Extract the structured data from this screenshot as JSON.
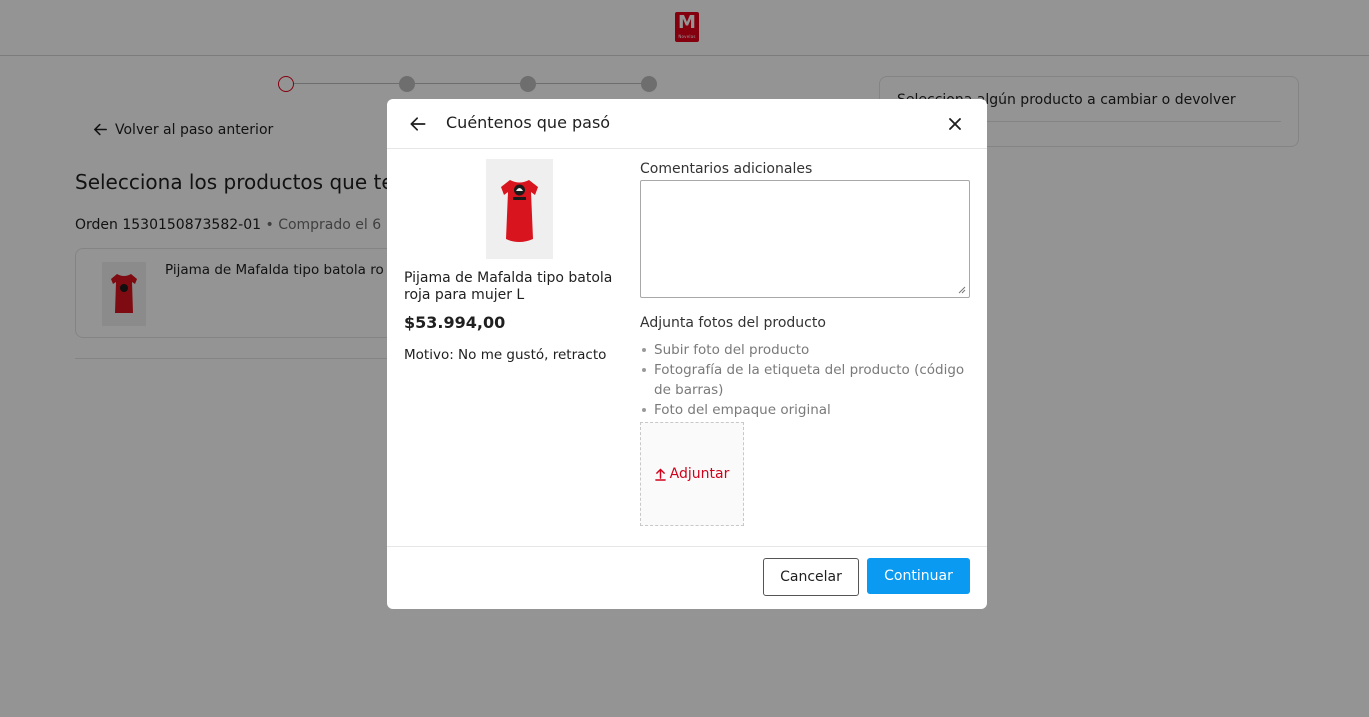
{
  "brand": {
    "logo_letter": "M",
    "logo_sub": "Novelas",
    "color": "#e3001b"
  },
  "stepper": {
    "steps": 4,
    "active": 1
  },
  "page": {
    "back_label": "Volver al paso anterior",
    "title": "Selecciona los productos que te",
    "order_label": "Orden 1530150873582-01",
    "order_separator": " • ",
    "purchased_label": "Comprado el 6",
    "product_name": "Pijama de Mafalda tipo batola ro"
  },
  "summary": {
    "text": "Selecciona algún producto a cambiar o devolver"
  },
  "modal": {
    "title": "Cuéntenos que pasó",
    "product_name": "Pijama de Mafalda tipo batola roja para mujer L",
    "price": "$53.994,00",
    "reason": "Motivo: No me gustó, retracto",
    "comments_label": "Comentarios adicionales",
    "comments_value": "",
    "photos_label": "Adjunta fotos del producto",
    "photo_requirements": [
      "Subir foto del producto",
      "Fotografía de la etiqueta del producto (código de barras)",
      "Foto del empaque original"
    ],
    "upload_label": "Adjuntar",
    "cancel_label": "Cancelar",
    "continue_label": "Continuar"
  },
  "colors": {
    "accent": "#0a9af2",
    "danger": "#d0021b",
    "overlay": "rgba(0,0,0,0.42)"
  },
  "icons": [
    "arrow-left-icon",
    "close-icon",
    "upload-icon",
    "resize-grip-icon"
  ]
}
